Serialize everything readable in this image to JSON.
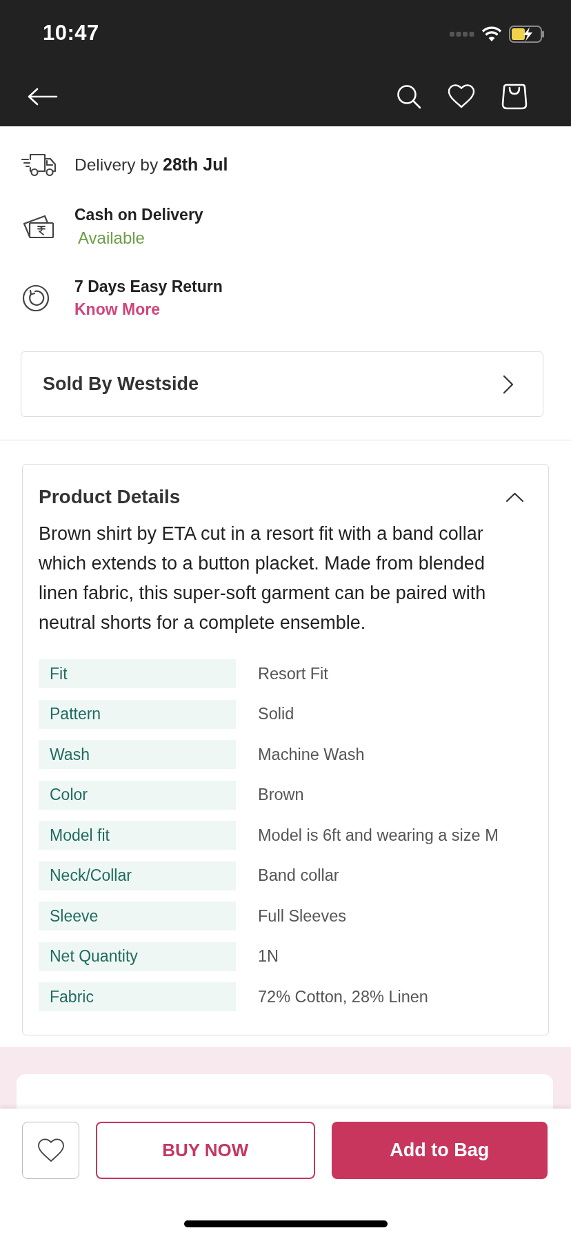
{
  "status_bar": {
    "time": "10:47"
  },
  "delivery_info": [
    {
      "kind": "delivery",
      "text": "Delivery by **28th Jul**"
    },
    {
      "kind": "cash_on_delivery",
      "title": "Cash on Delivery",
      "status": "Available"
    },
    {
      "kind": "returns",
      "title": "7 Days Easy Return",
      "link": "Know More"
    }
  ],
  "seller": {
    "label": "Sold By Westside"
  },
  "product_details": {
    "title": "Product Details",
    "expanded": true,
    "description": "Brown shirt by ETA cut in a resort fit with a band collar which extends to a button placket. Made from blended linen fabric, this super-soft garment can be paired with neutral shorts for a complete ensemble.",
    "specs": [
      {
        "label": "Fit",
        "value": "Resort Fit"
      },
      {
        "label": "Pattern",
        "value": "Solid"
      },
      {
        "label": "Wash",
        "value": "Machine Wash"
      },
      {
        "label": "Color",
        "value": "Brown"
      },
      {
        "label": "Model fit",
        "value": "Model is 6ft and wearing a size M"
      },
      {
        "label": "Neck/Collar",
        "value": "Band collar"
      },
      {
        "label": "Sleeve",
        "value": "Full Sleeves"
      },
      {
        "label": "Net Quantity",
        "value": "1N"
      },
      {
        "label": "Fabric",
        "value": "72% Cotton, 28% Linen"
      }
    ]
  },
  "action_bar": {
    "wishlisted": false,
    "buy_now": "BUY NOW",
    "add_to_bag": "Add to Bag"
  }
}
